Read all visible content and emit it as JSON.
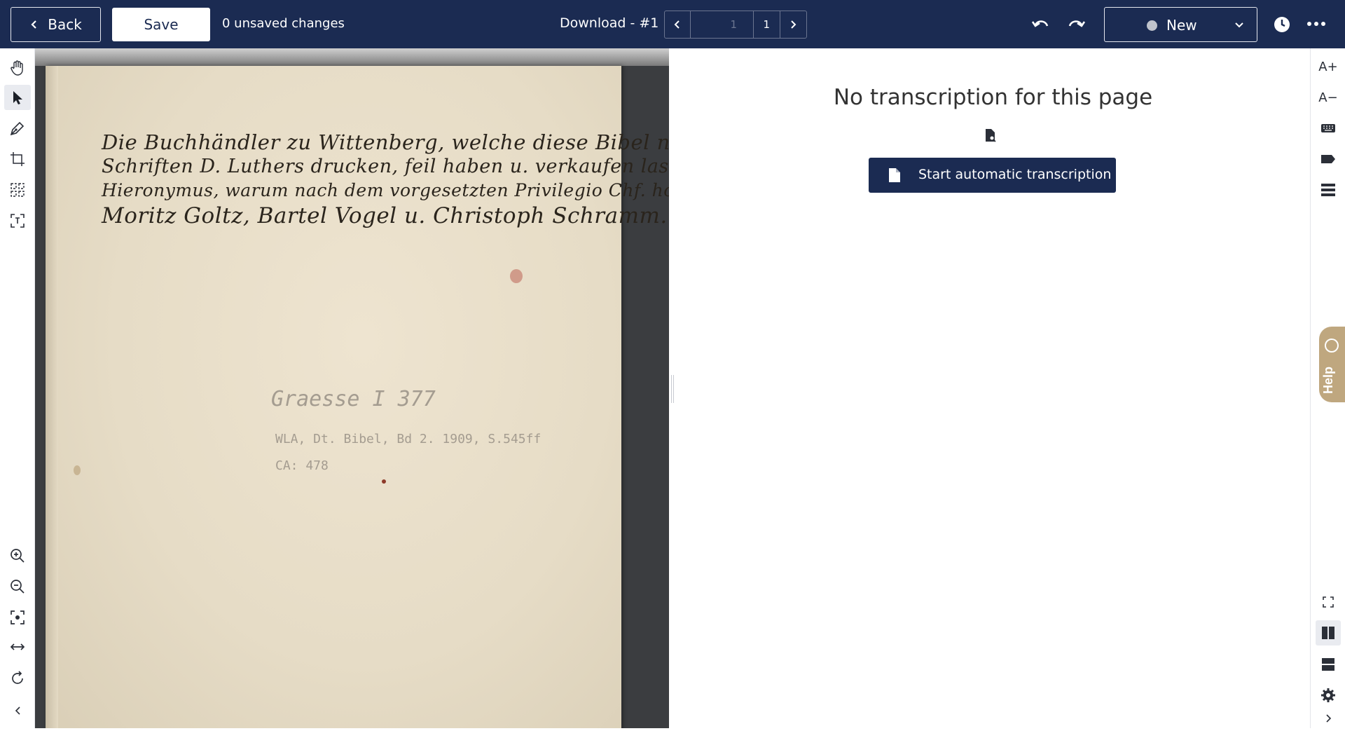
{
  "topbar": {
    "back_label": "Back",
    "save_label": "Save",
    "unsaved_text": "0 unsaved changes",
    "document_title": "Download - #1",
    "pager": {
      "current_placeholder": "1",
      "total": "1"
    },
    "status": {
      "label": "New",
      "dot_color": "#bfc3cc"
    },
    "bg_color": "#1b2b52"
  },
  "left_tools": [
    "hand-icon",
    "pointer-icon",
    "pen-icon",
    "crop-icon",
    "layout-grid-icon",
    "text-select-icon",
    "zoom-in-icon",
    "zoom-out-icon",
    "fit-screen-icon",
    "fit-width-icon",
    "rotate-icon",
    "collapse-left-icon"
  ],
  "document": {
    "handwriting_lines": [
      "Die Buchhändler zu Wittenberg, welche diese Bibel nebst andern",
      "Schriften D. Luthers drucken, feil haben u. verkaufen lassen",
      "Hieronymus, warum nach dem vorgesetzten Privilegio Chf. ho. Friedrichs",
      "Moritz Goltz, Bartel Vogel u. Christoph Schramm."
    ],
    "pencil_notes": [
      "Graesse I 377",
      "WLA, Dt. Bibel, Bd 2. 1909, S.545ff",
      "CA: 478"
    ]
  },
  "transcription": {
    "empty_message": "No transcription for this page",
    "start_button_label": "Start automatic transcription"
  },
  "right_tools": {
    "font_increase": "A+",
    "font_decrease": "A−"
  },
  "help_label": "Help"
}
